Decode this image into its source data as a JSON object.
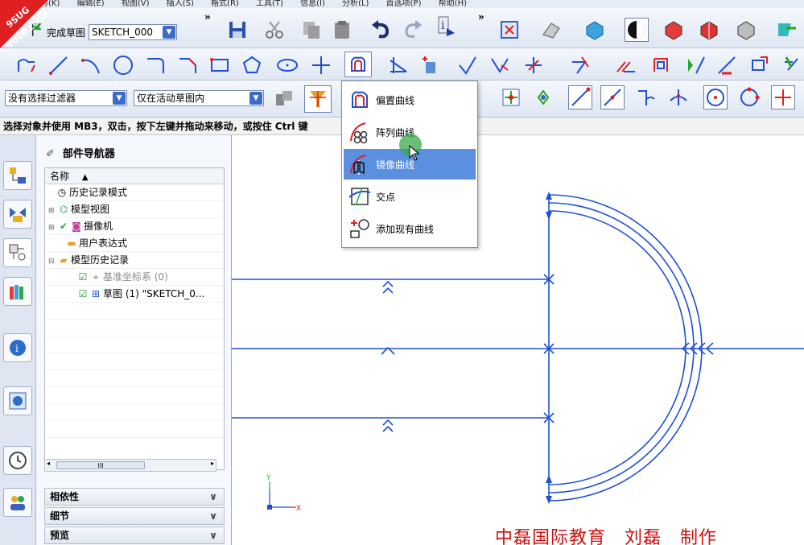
{
  "menubar": {
    "items": [
      "任务(K)",
      "编辑(E)",
      "视图(V)",
      "插入(S)",
      "格式(R)",
      "工具(T)",
      "信息(I)",
      "分析(L)",
      "首选项(P)",
      "帮助(H)"
    ]
  },
  "logo": {
    "text1": "9SUG",
    "text2": "学UG就上UG网"
  },
  "toolbar1": {
    "finish_sketch_label": "完成草图",
    "sketch_combo_value": "SKETCH_000",
    "overflow": "»"
  },
  "toolbar3": {
    "filter_combo_value": "没有选择过滤器",
    "scope_combo_value": "仅在活动草图内"
  },
  "statusbar": {
    "prompt": "选择对象并使用 MB3，双击，按下左键并拖动来移动，或按住 Ctrl 键"
  },
  "navigator": {
    "title": "部件导航器",
    "column_name": "名称",
    "sort_glyph": "▲",
    "rows": [
      {
        "label": "历史记录模式",
        "icon": "clock-icon"
      },
      {
        "label": "模型视图",
        "icon": "model-views-icon"
      },
      {
        "label": "摄像机",
        "icon": "camera-icon"
      },
      {
        "label": "用户表达式",
        "icon": "folder-icon"
      },
      {
        "label": "模型历史记录",
        "icon": "folder-open-icon"
      },
      {
        "label": "基准坐标系 (0)",
        "icon": "datum-csys-icon"
      },
      {
        "label": "草图 (1) \"SKETCH_0...",
        "icon": "sketch-icon"
      }
    ],
    "scroll_glyph": "III",
    "sections": [
      "相依性",
      "细节",
      "预览"
    ]
  },
  "dropdown": {
    "items": [
      {
        "label": "偏置曲线",
        "icon": "offset-curve-icon"
      },
      {
        "label": "阵列曲线",
        "icon": "pattern-curve-icon"
      },
      {
        "label": "镜像曲线",
        "icon": "mirror-curve-icon",
        "active": true
      },
      {
        "label": "交点",
        "icon": "intersection-point-icon"
      },
      {
        "label": "添加现有曲线",
        "icon": "add-existing-curve-icon"
      }
    ]
  },
  "canvas": {
    "axis_y_label": "Y",
    "axis_x_label": "X",
    "watermark": "中磊国际教育　刘磊　制作"
  },
  "colors": {
    "sketch_line": "#1f4fd6",
    "highlight": "#5b8fe0",
    "watermark": "#d01010"
  }
}
